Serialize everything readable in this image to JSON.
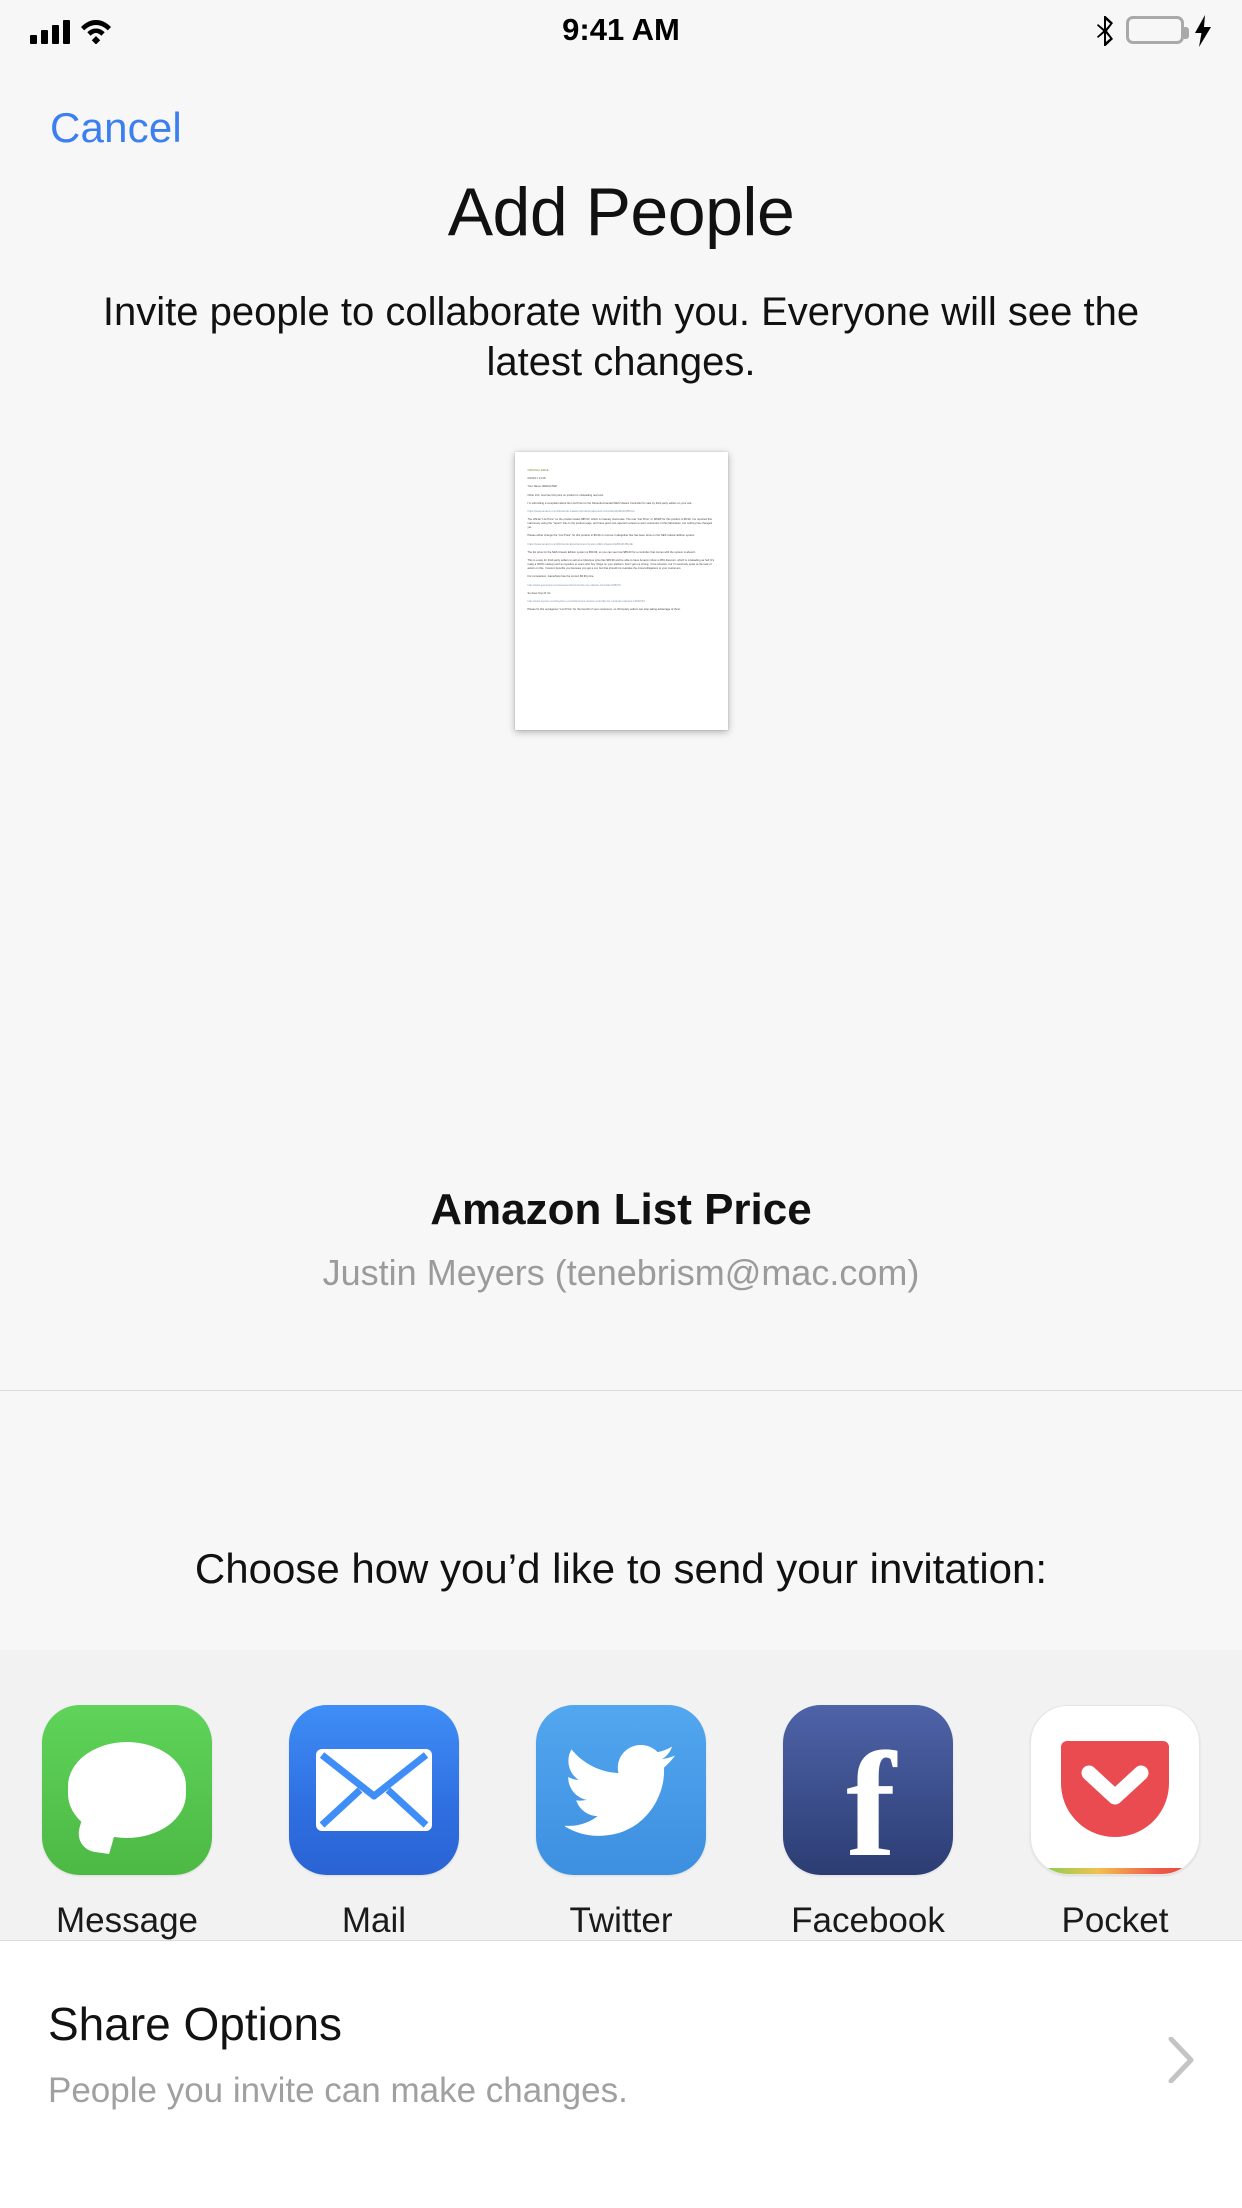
{
  "status_bar": {
    "time": "9:41 AM",
    "signal_icon": "cellular-bars-icon",
    "wifi_icon": "wifi-icon",
    "bluetooth_icon": "bluetooth-icon",
    "battery_icon": "battery-icon",
    "charging_icon": "charging-bolt-icon",
    "battery_color": "#6fd157"
  },
  "nav": {
    "cancel_label": "Cancel",
    "cancel_color": "#3b7ff0"
  },
  "header": {
    "title": "Add People",
    "subtitle": "Invite people to collaborate with you. Everyone will see the latest changes."
  },
  "document_preview": {
    "icon": "document-thumbnail",
    "lines": [
      {
        "text": "ORIGINAL EMAIL",
        "style": "head"
      },
      {
        "text": "03/02/17 14:48",
        "style": "meta"
      },
      {
        "text": "Your Name: REDACTED",
        "style": "body"
      },
      {
        "text": "Other info: Incorrect list price on product is misleading real cost",
        "style": "body"
      },
      {
        "text": "I'm submitting a complaint about the List Price for the Nintendo-branded NES Classic Controller for sale by third-party sellers on your site:",
        "style": "body"
      },
      {
        "text": "https://www.amazon.com/Nintendo-Classic-Mini-Entertainment-Controller/dp/B01IVIBCH4",
        "style": "link"
      },
      {
        "text": "The official \"List Price\" on the product states $85.00, which is insanely inaccurate. The real \"List Price\" or MSRP for this product is $9.99. I've reported this inaccuracy using the \"report\" link on the product page, and have given two rejected reviews to warn customers of this fabrication, but nothing has changed yet.",
        "style": "body"
      },
      {
        "text": "Please either change the \"List Price\" for this product to $9.99 or remove it altogether like has been done on the NES Classic Edition system:",
        "style": "body"
      },
      {
        "text": "https://www.amazon.com/Nintendo-Entertainment-System-NES-Classic/dp/B01IFJBQ1E",
        "style": "link"
      },
      {
        "text": "The list price for the NES Classic Edition system is $59.99, so you can see how $85.00 for a controller that comes with the system is absurd.",
        "style": "body"
      },
      {
        "text": "This is a way for third-party sellers to sell at a ridiculous price like $39.99 and be able to have Amazon show a 38% discount, which is misleading as hell (it's really a 400% markup) and an injustice to users who buy things on your platform. Don't get me wrong, I love Amazon, but I'm seriously upset at the lack of action on this. I know it benefits you because you get a cut, but that should not overtake the moral obligations to your customers.",
        "style": "body"
      },
      {
        "text": "For comparison, GameStop has the correct $9.99 price.",
        "style": "body"
      },
      {
        "text": "http://www.gamestop.com/accessories/nintendo-nes-classic-controller/138070",
        "style": "link"
      },
      {
        "text": "So does Toys R Us:",
        "style": "body"
      },
      {
        "text": "http://www.toysrus.com/buy/wii-u-controllers/nes-classic-controller-for-nintendo-classics-13030716",
        "style": "link"
      },
      {
        "text": "Please fix this outrageous \"List Price\" for the benefit of your customers, so third-party sellers can stop taking advantage of them.",
        "style": "body"
      }
    ]
  },
  "file": {
    "title": "Amazon List Price",
    "owner": "Justin Meyers (tenebrism@mac.com)"
  },
  "share": {
    "prompt": "Choose how you’d like to send your invitation:",
    "apps": [
      {
        "label": "Message",
        "icon": "message-app-icon"
      },
      {
        "label": "Mail",
        "icon": "mail-app-icon"
      },
      {
        "label": "Twitter",
        "icon": "twitter-app-icon"
      },
      {
        "label": "Facebook",
        "icon": "facebook-app-icon"
      },
      {
        "label": "Pocket",
        "icon": "pocket-app-icon"
      }
    ]
  },
  "share_options": {
    "title": "Share Options",
    "subtitle": "People you invite can make changes.",
    "chevron_icon": "chevron-right-icon"
  }
}
